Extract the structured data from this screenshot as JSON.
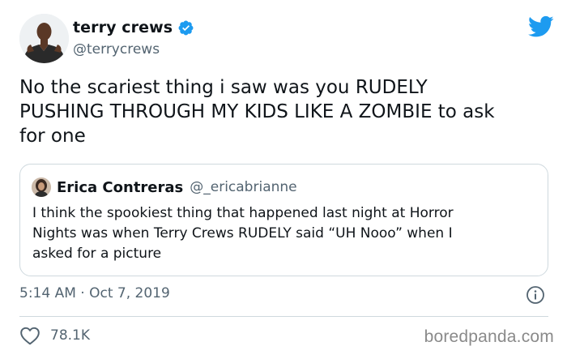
{
  "author": {
    "display_name": "terry crews",
    "handle": "@terrycrews",
    "verified": true
  },
  "tweet": {
    "text_lines": [
      "No the scariest thing i saw was you RUDELY",
      "PUSHING THROUGH MY KIDS LIKE A ZOMBIE to ask",
      "for one"
    ]
  },
  "quoted_tweet": {
    "display_name": "Erica Contreras",
    "handle": "@_ericabrianne",
    "text_lines": [
      "I think the spookiest thing that happened last night at Horror",
      "Nights was when Terry Crews RUDELY said “UH Nooo” when I",
      "asked for a picture"
    ]
  },
  "meta": {
    "timestamp": "5:14 AM · Oct 7, 2019"
  },
  "stats": {
    "likes": "78.1K"
  },
  "watermark": "boredpanda.com",
  "colors": {
    "twitter_blue": "#1d9bf0",
    "text": "#0f1419",
    "secondary": "#536471",
    "border": "#cfd9de"
  },
  "icons": [
    "verified-badge-icon",
    "twitter-bird-icon",
    "info-icon",
    "heart-icon"
  ]
}
